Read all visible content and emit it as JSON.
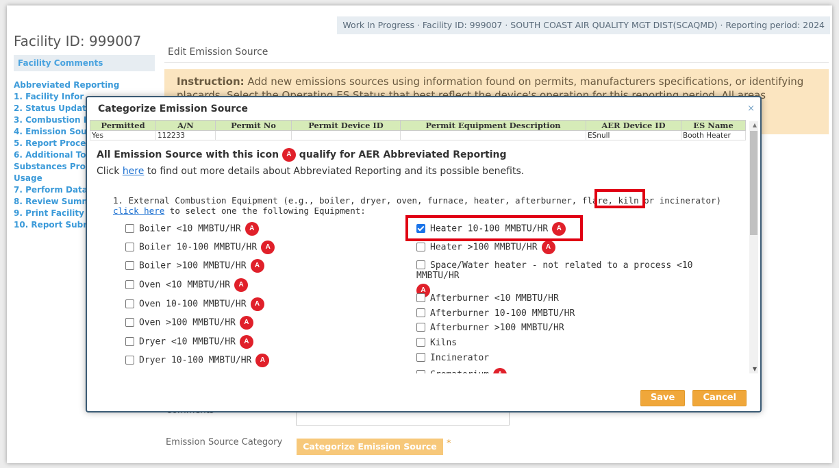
{
  "header": {
    "status_line": "Work In Progress · Facility ID: 999007 · SOUTH COAST AIR QUALITY MGT DIST(SCAQMD) · Reporting period: 2024"
  },
  "sidebar": {
    "facility_title": "Facility ID: 999007",
    "facility_comments": "Facility Comments",
    "items": [
      {
        "label": "Abbreviated Reporting"
      },
      {
        "label": "1. Facility Infor"
      },
      {
        "label": "2. Status Updat"
      },
      {
        "label": "3. Combustion F"
      },
      {
        "label": "4. Emission Sou"
      },
      {
        "label": "5. Report Proce"
      },
      {
        "label": "6. Additional To"
      },
      {
        "label": "Substances Proc"
      },
      {
        "label": "Usage"
      },
      {
        "label": "7. Perform Data"
      },
      {
        "label": "8. Review Summ"
      },
      {
        "label": "9. Print Facility"
      },
      {
        "label": "10. Report Subr"
      }
    ]
  },
  "main": {
    "edit_title": "Edit Emission Source",
    "instruction_label": "Instruction:",
    "instruction_text": "Add new emissions sources using information found on permits, manufacturers specifications, or identifying placards. Select the Operating ES Status that best reflect the device's operation for this reporting period. All areas",
    "comments_label": "Comments",
    "emission_source_category_label": "Emission Source Category",
    "categorize_button": "Categorize Emission Source",
    "required_mark": "*"
  },
  "modal": {
    "title": "Categorize Emission Source",
    "close_icon": "×",
    "table": {
      "columns": [
        "Permitted",
        "A/N",
        "Permit No",
        "Permit Device ID",
        "Permit Equipment Description",
        "AER Device ID",
        "ES Name"
      ],
      "rows": [
        [
          "Yes",
          "112233",
          "",
          "",
          "",
          "ESnull",
          "Booth Heater"
        ]
      ]
    },
    "abbr_prefix": "All Emission Source with this icon",
    "abbr_suffix": "qualify for AER Abbreviated Reporting",
    "badge_letter": "A",
    "click_prefix": "Click",
    "click_link": "here",
    "click_suffix": "to find out more details about Abbreviated Reporting and its possible benefits.",
    "q1_prefix": "1. External Combustion Equipment (e.g., boiler, dryer, oven, furnace, heater, afterburner, flare, kiln or incinerator)",
    "q1_link": "click here",
    "q1_suffix": "to select one the following Equipment:",
    "left_options": [
      {
        "label": "Boiler <10 MMBTU/HR",
        "abbr": true,
        "checked": false
      },
      {
        "label": "Boiler 10-100 MMBTU/HR",
        "abbr": true,
        "checked": false
      },
      {
        "label": "Boiler >100 MMBTU/HR",
        "abbr": true,
        "checked": false
      },
      {
        "label": "Oven <10 MMBTU/HR",
        "abbr": true,
        "checked": false
      },
      {
        "label": "Oven 10-100 MMBTU/HR",
        "abbr": true,
        "checked": false
      },
      {
        "label": "Oven >100 MMBTU/HR",
        "abbr": true,
        "checked": false
      },
      {
        "label": "Dryer <10 MMBTU/HR",
        "abbr": true,
        "checked": false
      },
      {
        "label": "Dryer 10-100 MMBTU/HR",
        "abbr": true,
        "checked": false
      }
    ],
    "right_options": [
      {
        "label": "Heater 10-100 MMBTU/HR",
        "abbr": true,
        "checked": true
      },
      {
        "label": "Heater >100 MMBTU/HR",
        "abbr": true,
        "checked": false
      },
      {
        "label": "Space/Water heater - not related to a process <10 MMBTU/HR",
        "abbr": true,
        "checked": false
      },
      {
        "label": "Afterburner <10 MMBTU/HR",
        "abbr": false,
        "checked": false
      },
      {
        "label": "Afterburner 10-100 MMBTU/HR",
        "abbr": false,
        "checked": false
      },
      {
        "label": "Afterburner >100 MMBTU/HR",
        "abbr": false,
        "checked": false
      },
      {
        "label": "Kilns",
        "abbr": false,
        "checked": false
      },
      {
        "label": "Incinerator",
        "abbr": false,
        "checked": false
      },
      {
        "label": "Crematorium",
        "abbr": true,
        "checked": false
      }
    ],
    "save_button": "Save",
    "cancel_button": "Cancel"
  },
  "colors": {
    "badge_red": "#e0202a",
    "highlight_red": "#e00012",
    "button_orange": "#f0a73a",
    "table_header_green": "#d6ebb8",
    "link_blue": "#1a6fd1"
  }
}
